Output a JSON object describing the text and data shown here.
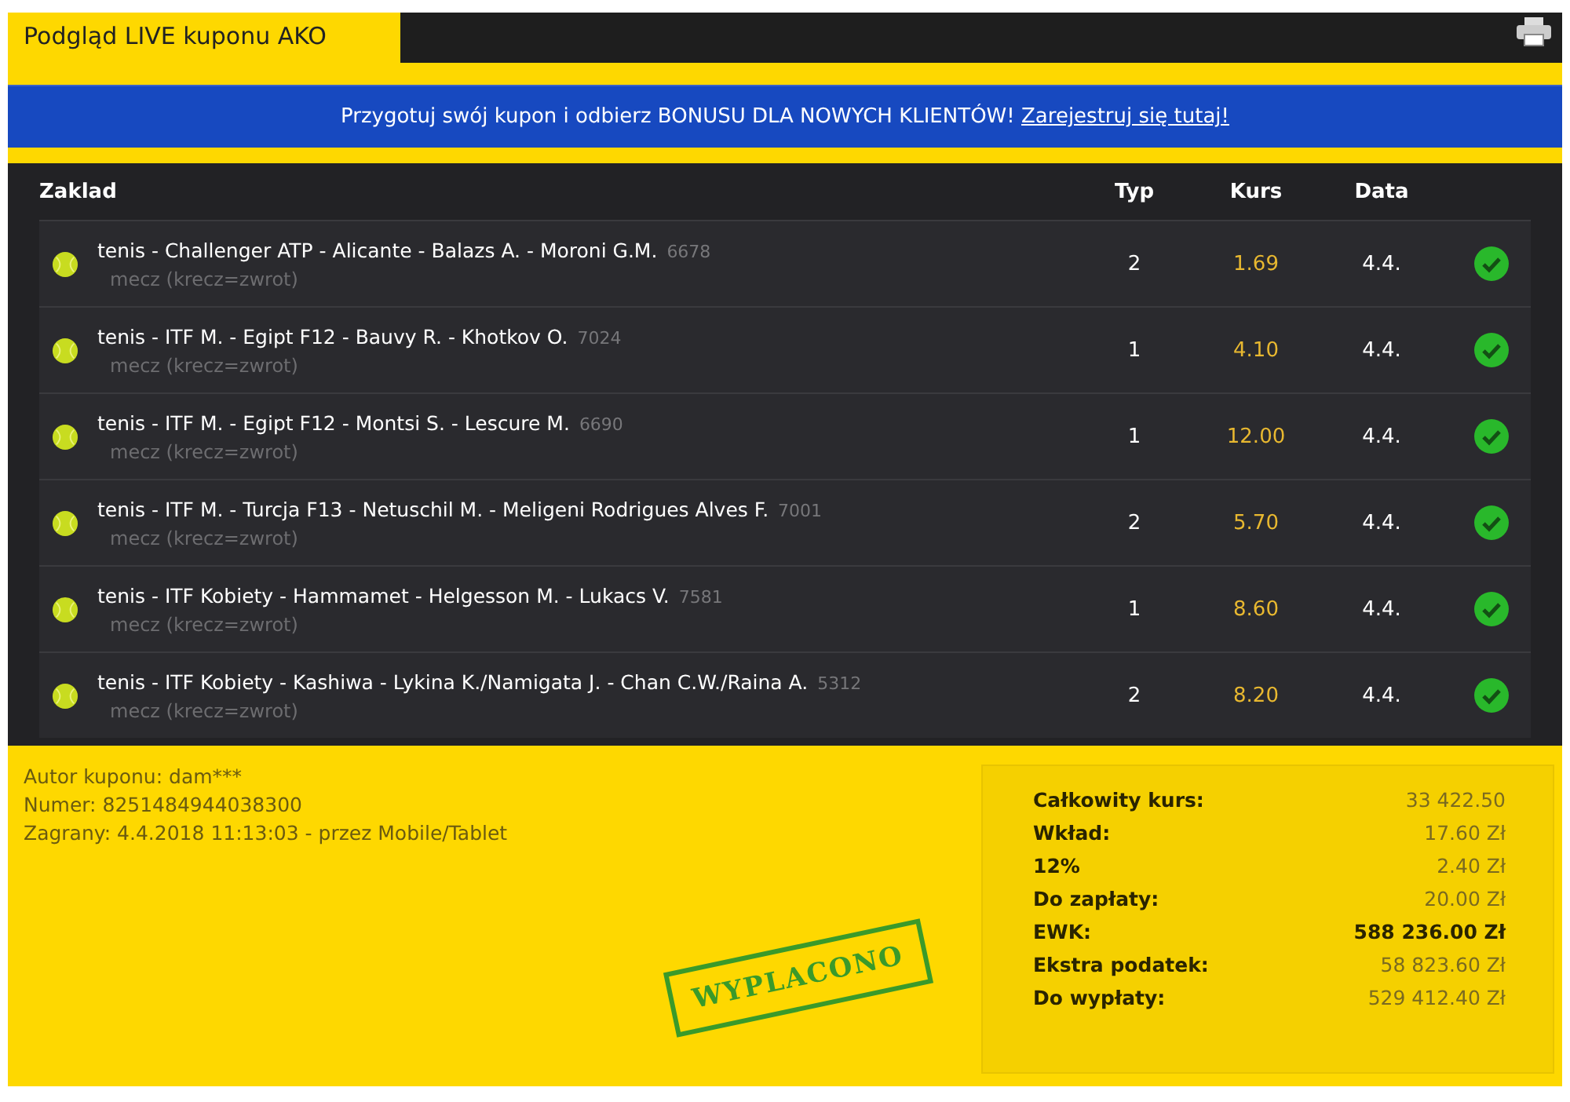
{
  "header": {
    "tab": "Podgląd LIVE kuponu AKO"
  },
  "banner": {
    "text": "Przygotuj swój kupon i odbierz BONUSU DLA NOWYCH KLIENTÓW!",
    "link": "Zarejestruj się tutaj!"
  },
  "table": {
    "columns": [
      "Zaklad",
      "Typ",
      "Kurs",
      "Data"
    ],
    "rows": [
      {
        "event": "tenis - Challenger ATP - Alicante - Balazs A. - Moroni G.M.",
        "code": "6678",
        "market": "mecz (krecz=zwrot)",
        "type": "2",
        "odds": "1.69",
        "date": "4.4.",
        "won": true
      },
      {
        "event": "tenis - ITF M. - Egipt F12 - Bauvy R. - Khotkov O.",
        "code": "7024",
        "market": "mecz (krecz=zwrot)",
        "type": "1",
        "odds": "4.10",
        "date": "4.4.",
        "won": true
      },
      {
        "event": "tenis - ITF M. - Egipt F12 - Montsi S. - Lescure M.",
        "code": "6690",
        "market": "mecz (krecz=zwrot)",
        "type": "1",
        "odds": "12.00",
        "date": "4.4.",
        "won": true
      },
      {
        "event": "tenis - ITF M. - Turcja F13 - Netuschil M. - Meligeni Rodrigues Alves F.",
        "code": "7001",
        "market": "mecz (krecz=zwrot)",
        "type": "2",
        "odds": "5.70",
        "date": "4.4.",
        "won": true
      },
      {
        "event": "tenis - ITF Kobiety - Hammamet - Helgesson M. - Lukacs V.",
        "code": "7581",
        "market": "mecz (krecz=zwrot)",
        "type": "1",
        "odds": "8.60",
        "date": "4.4.",
        "won": true
      },
      {
        "event": "tenis - ITF Kobiety - Kashiwa - Lykina K./Namigata J. - Chan C.W./Raina A.",
        "code": "5312",
        "market": "mecz (krecz=zwrot)",
        "type": "2",
        "odds": "8.20",
        "date": "4.4.",
        "won": true
      }
    ]
  },
  "info": [
    "Autor kuponu: dam***",
    "Numer: 8251484944038300",
    "Zagrany: 4.4.2018 11:13:03 - przez Mobile/Tablet"
  ],
  "stamp": "WYPLACONO",
  "summary": [
    {
      "label": "Całkowity kurs:",
      "value": "33 422.50",
      "emphasis": false
    },
    {
      "label": "Wkład:",
      "value": "17.60 Zł",
      "emphasis": false
    },
    {
      "label": "12%",
      "value": "2.40 Zł",
      "emphasis": false
    },
    {
      "label": "Do zapłaty:",
      "value": "20.00 Zł",
      "emphasis": false
    },
    {
      "label": "EWK:",
      "value": "588 236.00 Zł",
      "emphasis": true
    },
    {
      "label": "Ekstra podatek:",
      "value": "58 823.60 Zł",
      "emphasis": false
    },
    {
      "label": "Do wypłaty:",
      "value": "529 412.40 Zł",
      "emphasis": false
    }
  ]
}
